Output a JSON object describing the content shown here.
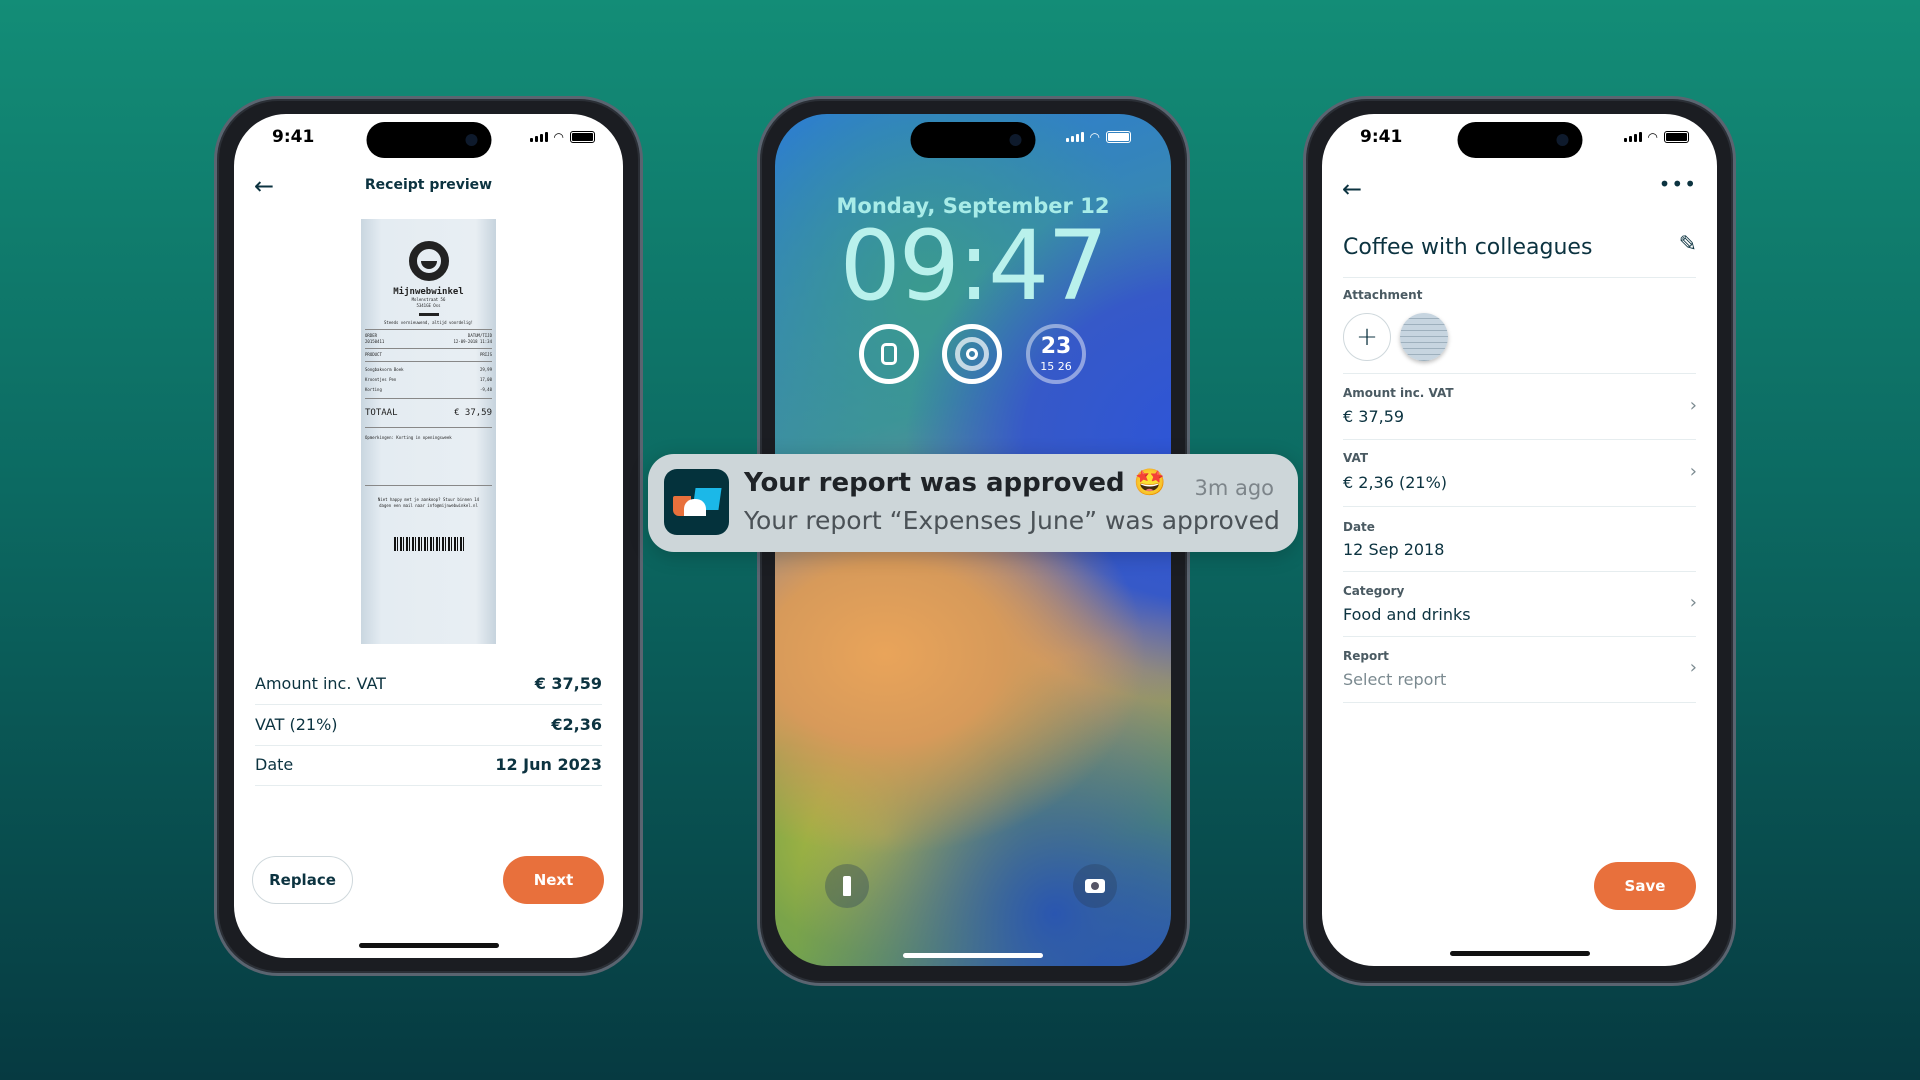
{
  "colors": {
    "accent": "#e8703c",
    "text": "#0c3340",
    "background_top": "#138d77",
    "background_bottom": "#063a41"
  },
  "left_phone": {
    "status_time": "9:41",
    "header": {
      "title": "Receipt preview",
      "back_icon": "arrow-left-icon"
    },
    "receipt": {
      "shop": "Mijnwebwinkel",
      "address": "Molenstraat 56",
      "city": "5341GE Oss",
      "slogan": "Steeds vernieuwend, altijd voordelig!",
      "order_label": "ORDER",
      "order_no": "20150411",
      "date_label": "DATUM/TIJD",
      "date": "12-09-2018 11:34",
      "product_label": "PRODUCT",
      "price_label": "PRIJS",
      "items": [
        {
          "name": "Songbakvorm Boek",
          "price": "29,99"
        },
        {
          "name": "Kroontjes Pen",
          "price": "17,00"
        },
        {
          "name": "Korting",
          "price": "-9,40"
        }
      ],
      "total_label": "TOTAAL",
      "total": "€ 37,59",
      "remarks": "Opmerkingen: Korting in openingsweek",
      "footer": "Niet happy met je aankoop? Stuur binnen 14 dagen een mail naar info@mijnwebwinkel.nl"
    },
    "rows": [
      {
        "label": "Amount inc. VAT",
        "value": "€ 37,59"
      },
      {
        "label": "VAT (21%)",
        "value": "€2,36"
      },
      {
        "label": "Date",
        "value": "12 Jun 2023"
      }
    ],
    "replace_label": "Replace",
    "next_label": "Next"
  },
  "middle_phone": {
    "date": "Monday, September 12",
    "time": "09:47",
    "widgets": {
      "watch_icon": "watch-icon",
      "activity_icon": "activity-rings-icon",
      "temperature": "23",
      "temp_low": "15",
      "temp_high": "26"
    },
    "flashlight_icon": "flashlight-icon",
    "camera_icon": "camera-icon"
  },
  "notification": {
    "title": "Your report was approved",
    "emoji": "🤩",
    "time": "3m ago",
    "body": "Your report “Expenses June” was approved"
  },
  "right_phone": {
    "status_time": "9:41",
    "title": "Coffee with colleagues",
    "attachment_label": "Attachment",
    "fields": [
      {
        "label": "Amount inc. VAT",
        "value": "€ 37,59"
      },
      {
        "label": "VAT",
        "value": "€ 2,36 (21%)"
      },
      {
        "label": "Date",
        "value": "12 Sep 2018"
      },
      {
        "label": "Category",
        "value": "Food and drinks"
      },
      {
        "label": "Report",
        "value": "Select report"
      }
    ],
    "save_label": "Save"
  }
}
